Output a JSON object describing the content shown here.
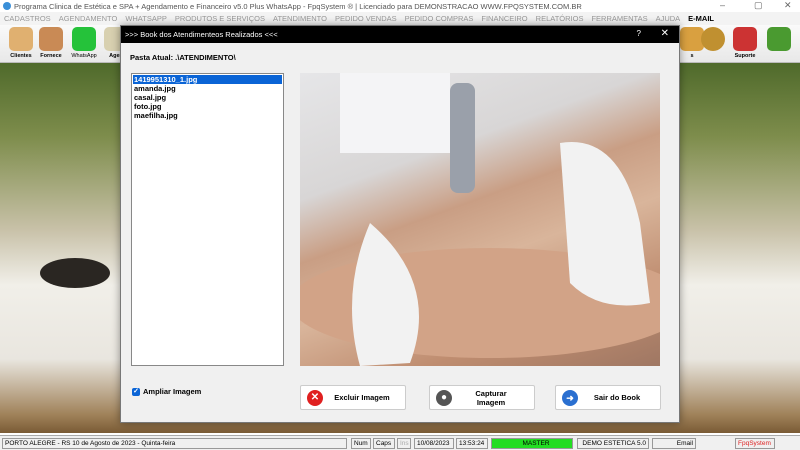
{
  "window": {
    "title": "Programa Clinica de Estética e SPA + Agendamento e Financeiro v5.0 Plus WhatsApp - FpqSystem ® | Licenciado para  DEMONSTRACAO WWW.FPQSYSTEM.COM.BR",
    "minimize": "–",
    "maximize": "▢",
    "close": "✕"
  },
  "menu": [
    "CADASTROS",
    "AGENDAMENTO",
    "WHATSAPP",
    "PRODUTOS E SERVIÇOS",
    "ATENDIMENTO",
    "PEDIDO VENDAS",
    "PEDIDO COMPRAS",
    "FINANCEIRO",
    "RELATÓRIOS",
    "FERRAMENTAS",
    "AJUDA",
    "E-MAIL"
  ],
  "toolbar": {
    "clientes": "Clientes",
    "fornece": "Fornece",
    "whatsapp": "WhatsApp",
    "agenda": "Agen",
    "hidden": "s",
    "suporte": "Suporte"
  },
  "dialog": {
    "title": ">>>  Book dos Atendimenteos Realizados  <<<",
    "help": "?",
    "close": "✕",
    "pasta": "Pasta Atual: .\\ATENDIMENTO\\",
    "files": [
      "1419951310_1.jpg",
      "amanda.jpg",
      "casal.jpg",
      "foto.jpg",
      "maefilha.jpg"
    ],
    "selected_file": "1419951310_1.jpg",
    "ampliar": "Ampliar Imagem",
    "ampliar_checked": true,
    "excluir": "Excluir Imagem",
    "capturar": "Capturar Imagem",
    "sair": "Sair do Book"
  },
  "status": {
    "location": "PORTO ALEGRE - RS 10 de Agosto de 2023 - Quinta-feira",
    "num": "Num",
    "caps": "Caps",
    "ins": "Ins",
    "date": "10/08/2023",
    "time": "13:53:24",
    "user": "MASTER",
    "company": "DEMO ESTETICA 5.0",
    "email": "Email",
    "brand": "FpqSystem"
  }
}
